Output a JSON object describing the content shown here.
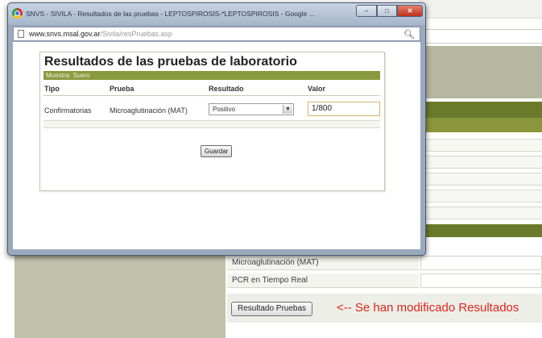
{
  "window": {
    "title": "SNVS - SIVILA - Resultados de las pruebas - LEPTOSPIROSIS-*LEPTOSPIROSIS - Google ...",
    "url_domain": "www.snvs.msal.gov.ar",
    "url_path": "/Sivila/resPruebas.asp",
    "minimize_glyph": "–",
    "maximize_glyph": "□",
    "close_glyph": "✕"
  },
  "results": {
    "title": "Resultados de las pruebas de laboratorio",
    "sample": "Muestra: Suero",
    "columns": [
      "Tipo",
      "Prueba",
      "Resultado",
      "Valor"
    ],
    "row": {
      "tipo": "Confirmatorias",
      "prueba": "Microaglutinación (MAT)",
      "resultado": "Positivo",
      "valor": "1/800"
    },
    "save_label": "Guardar"
  },
  "background": {
    "rows": [
      {
        "label": "Microaglutinación (MAT)"
      },
      {
        "label": "PCR en Tiempo Real"
      }
    ],
    "results_button": "Resultado Pruebas",
    "note": "<-- Se han modificado Resultados"
  },
  "colors": {
    "olive_dark": "#6a7a2a",
    "olive_header": "#8a9a3e",
    "olive_panel": "#c2c1ab",
    "note_red": "#e0261c"
  },
  "icons": {
    "browser": "chrome-icon",
    "page": "page-icon",
    "search": "search-icon",
    "dropdown": "chevron-down-icon"
  }
}
